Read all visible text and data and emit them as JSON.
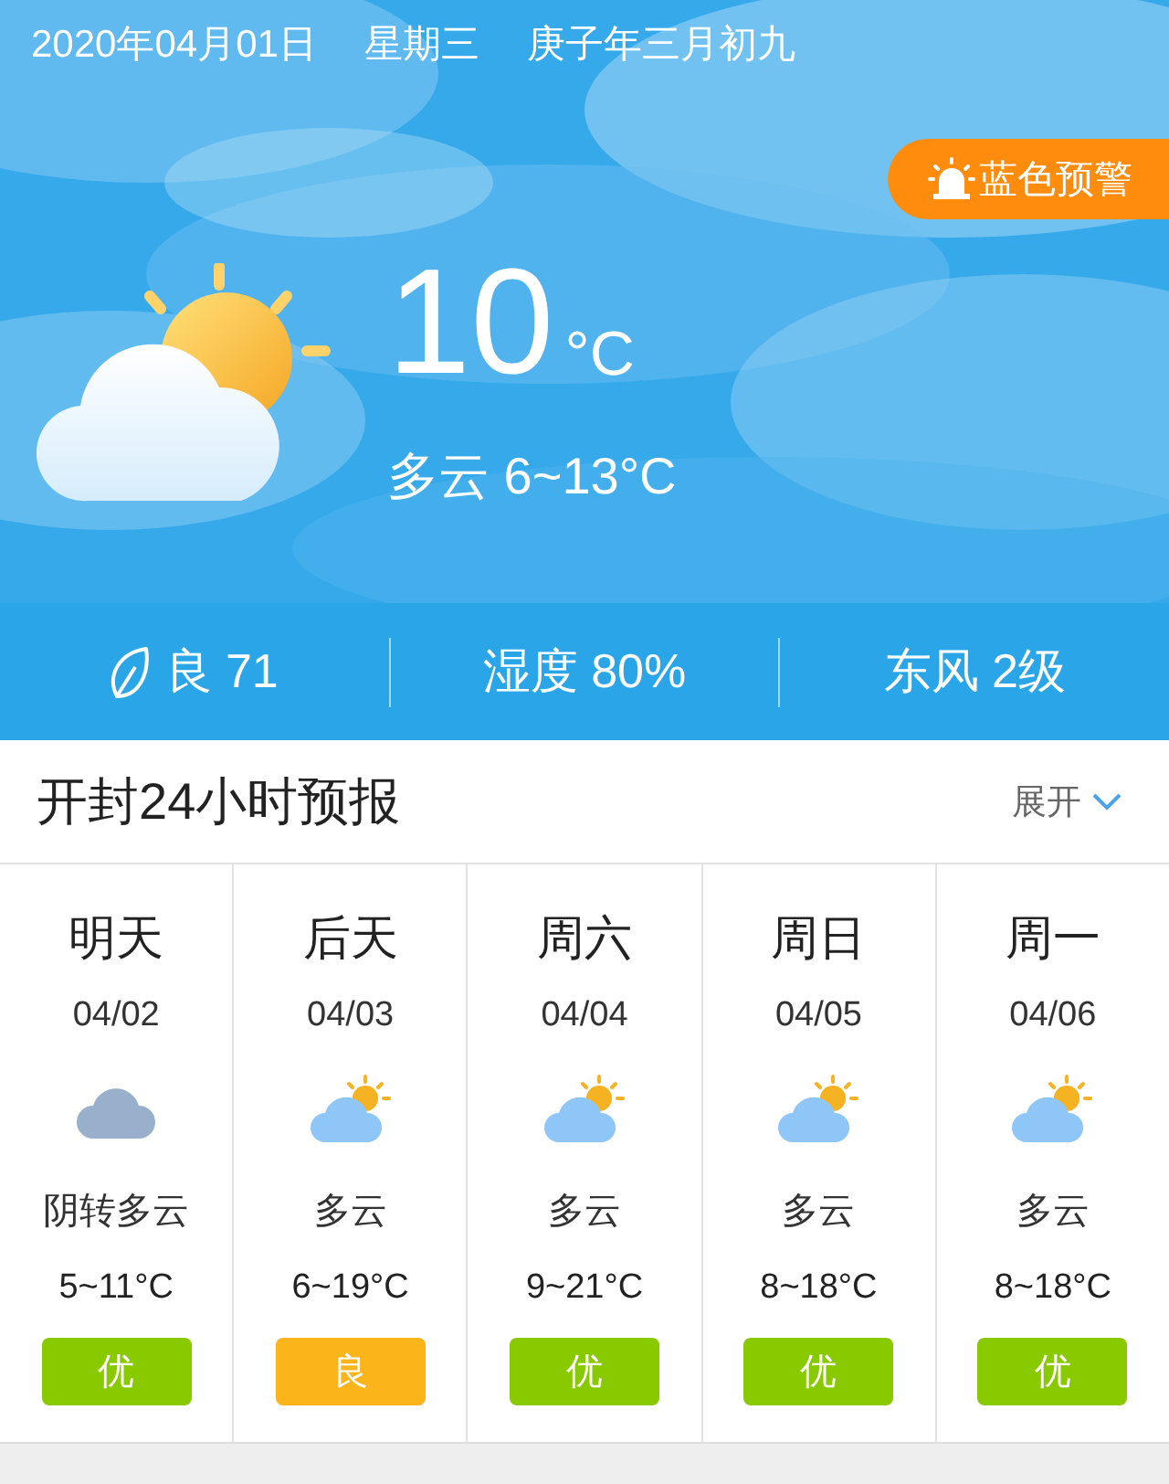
{
  "date": "2020年04月01日",
  "weekday": "星期三",
  "lunar": "庚子年三月初九",
  "alert": {
    "label": "蓝色预警"
  },
  "current": {
    "temperature": "10",
    "unit": "°C",
    "summary": "多云 6~13°C",
    "kind": "partly-cloudy"
  },
  "stats": [
    {
      "kind": "air",
      "text": "良 71"
    },
    {
      "kind": "plain",
      "text": "湿度 80%"
    },
    {
      "kind": "plain",
      "text": "东风 2级"
    }
  ],
  "forecast_header": {
    "title": "开封24小时预报",
    "toggle": "展开"
  },
  "days": [
    {
      "day": "明天",
      "date": "04/02",
      "kind": "overcast",
      "condition": "阴转多云",
      "temp": "5~11°C",
      "aqi": "优",
      "color": "#88c900"
    },
    {
      "day": "后天",
      "date": "04/03",
      "kind": "partly-cloudy",
      "condition": "多云",
      "temp": "6~19°C",
      "aqi": "良",
      "color": "#fbb419"
    },
    {
      "day": "周六",
      "date": "04/04",
      "kind": "partly-cloudy",
      "condition": "多云",
      "temp": "9~21°C",
      "aqi": "优",
      "color": "#88c900"
    },
    {
      "day": "周日",
      "date": "04/05",
      "kind": "partly-cloudy",
      "condition": "多云",
      "temp": "8~18°C",
      "aqi": "优",
      "color": "#88c900"
    },
    {
      "day": "周一",
      "date": "04/06",
      "kind": "partly-cloudy",
      "condition": "多云",
      "temp": "8~18°C",
      "aqi": "优",
      "color": "#88c900"
    }
  ]
}
